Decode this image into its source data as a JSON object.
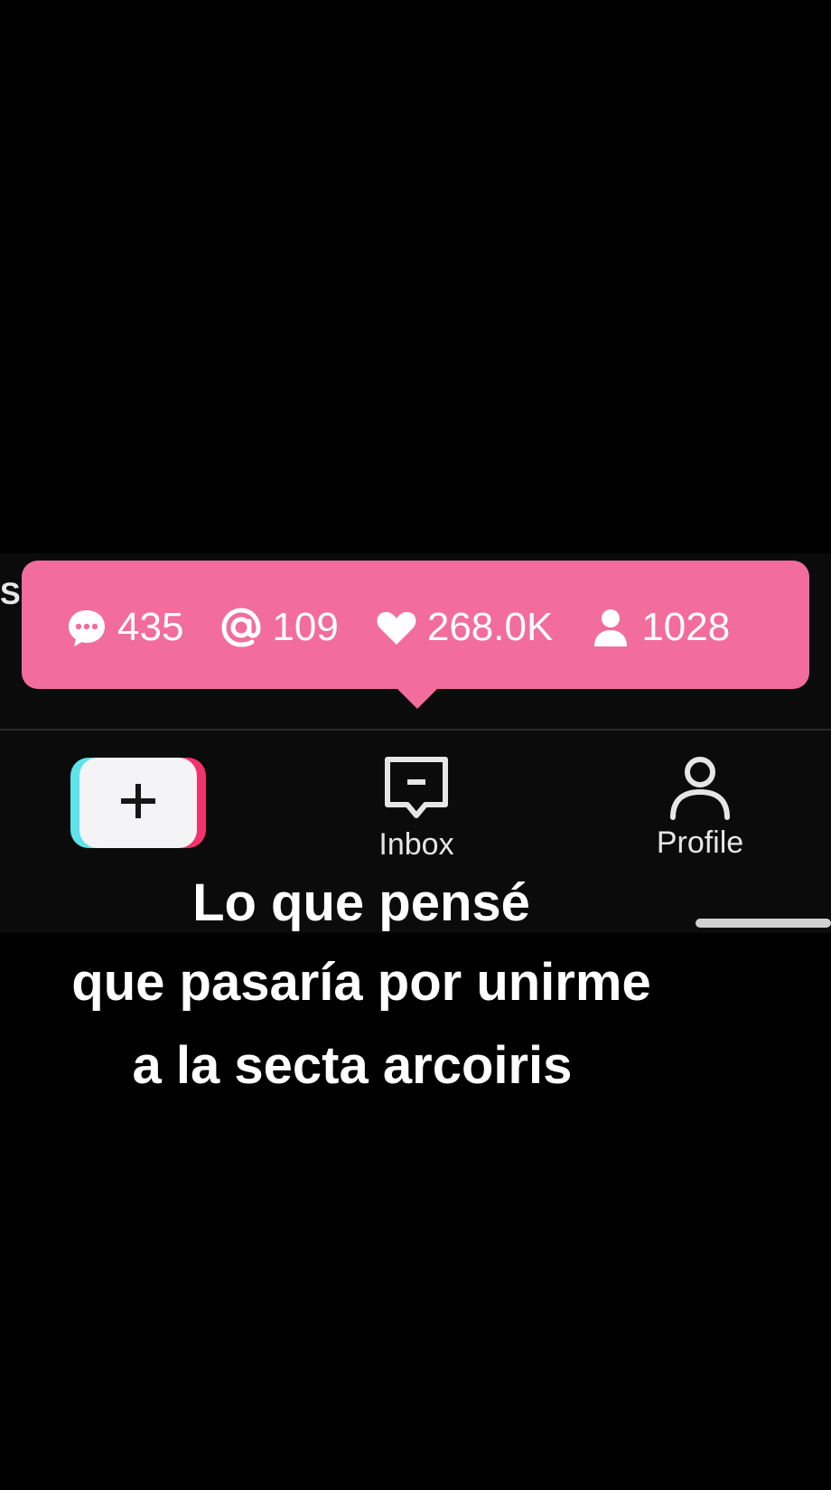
{
  "side_letter": "S",
  "tooltip": {
    "comments": "435",
    "mentions": "109",
    "likes": "268.0K",
    "followers": "1028"
  },
  "nav": {
    "inbox_label": "Inbox",
    "profile_label": "Profile"
  },
  "caption": {
    "line1": "Lo que pensé",
    "line2": "que pasaría por unirme",
    "line3": "a la secta arcoiris"
  },
  "colors": {
    "tooltip": "#f26d9c",
    "create_cyan": "#5ee3ea",
    "create_pink": "#f0346b"
  },
  "icons": [
    "comment-icon",
    "mention-icon",
    "heart-icon",
    "person-icon",
    "plus-icon",
    "inbox-icon",
    "profile-icon"
  ]
}
